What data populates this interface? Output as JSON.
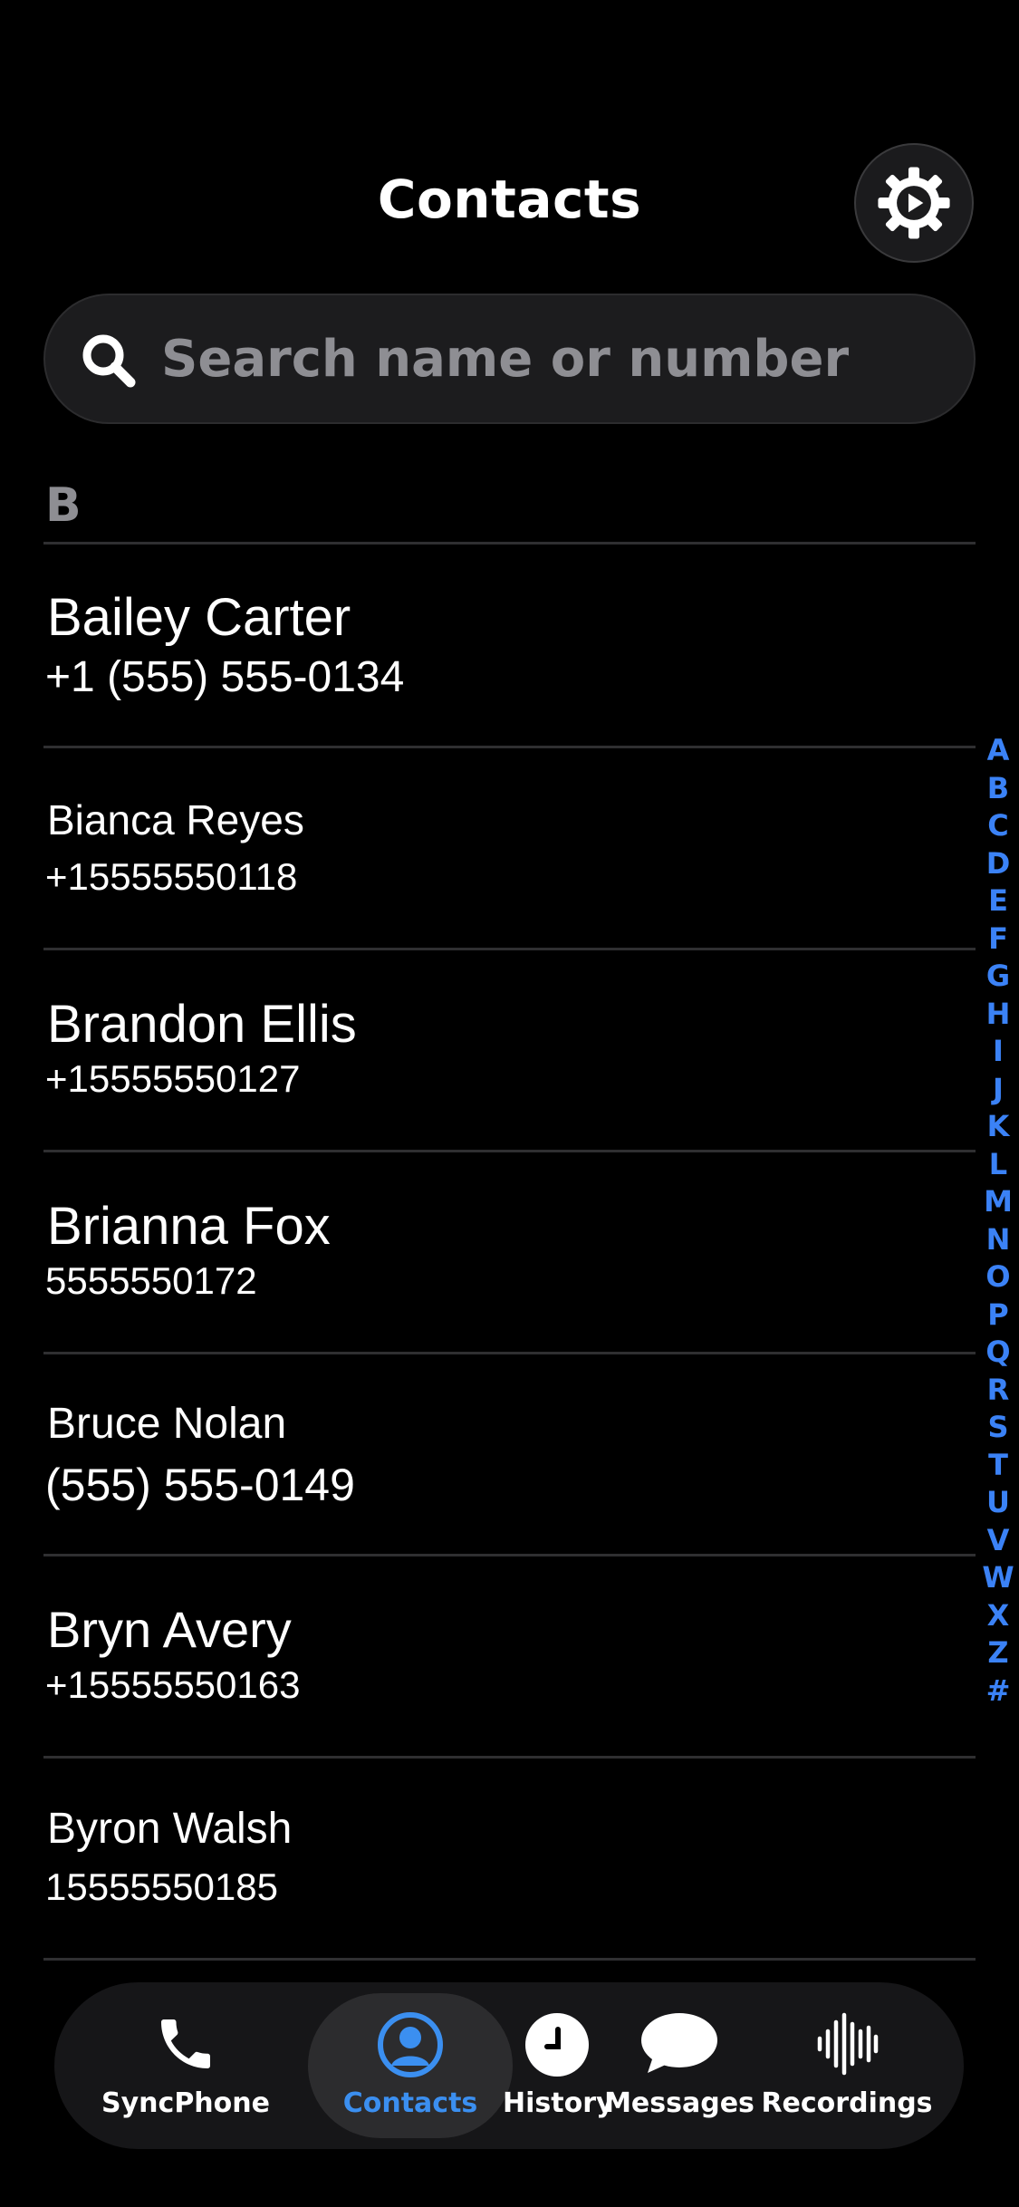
{
  "header": {
    "title": "Contacts"
  },
  "search": {
    "placeholder": "Search name or number"
  },
  "section": {
    "letter": "B"
  },
  "contacts": [
    {
      "name": "Bailey Carter",
      "phone": "+1 (555) 555-0134"
    },
    {
      "name": "Bianca Reyes",
      "phone": "+15555550118"
    },
    {
      "name": "Brandon Ellis",
      "phone": "+15555550127"
    },
    {
      "name": "Brianna Fox",
      "phone": "5555550172"
    },
    {
      "name": "Bruce Nolan",
      "phone": "(555) 555-0149"
    },
    {
      "name": "Bryn Avery",
      "phone": "+15555550163"
    },
    {
      "name": "Byron Walsh",
      "phone": "15555550185"
    }
  ],
  "alphabet_index": [
    "A",
    "B",
    "C",
    "D",
    "E",
    "F",
    "G",
    "H",
    "I",
    "J",
    "K",
    "L",
    "M",
    "N",
    "O",
    "P",
    "Q",
    "R",
    "S",
    "T",
    "U",
    "V",
    "W",
    "X",
    "Z",
    "#"
  ],
  "tabs": [
    {
      "label": "SyncPhone",
      "icon": "phone-icon",
      "active": false
    },
    {
      "label": "Contacts",
      "icon": "person-circle-icon",
      "active": true
    },
    {
      "label": "History",
      "icon": "clock-icon",
      "active": false
    },
    {
      "label": "Messages",
      "icon": "message-bubble-icon",
      "active": false
    },
    {
      "label": "Recordings",
      "icon": "waveform-icon",
      "active": false
    }
  ],
  "colors": {
    "accent": "#3b8ff0",
    "background": "#000000",
    "divider": "#2f2f31",
    "secondary_text": "#8e8e93"
  }
}
